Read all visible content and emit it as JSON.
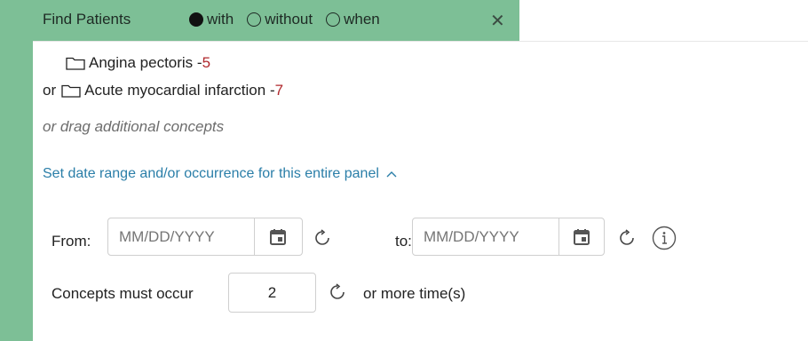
{
  "header": {
    "title": "Find Patients",
    "options": [
      {
        "label": "with",
        "selected": true
      },
      {
        "label": "without",
        "selected": false
      },
      {
        "label": "when",
        "selected": false
      }
    ],
    "close_glyph": "✕"
  },
  "concepts": [
    {
      "prefix": "",
      "name": "Angina pectoris - ",
      "count": "5"
    },
    {
      "prefix": "or",
      "name": "Acute myocardial infarction - ",
      "count": "7"
    }
  ],
  "drag_hint": "or drag additional concepts",
  "date_range_link": "Set date range and/or occurrence for this entire panel",
  "from": {
    "label": "From:",
    "placeholder": "MM/DD/YYYY",
    "value": ""
  },
  "to": {
    "label": "to:",
    "placeholder": "MM/DD/YYYY",
    "value": ""
  },
  "occurrence": {
    "label": "Concepts must occur",
    "value": "2",
    "suffix": "or more time(s)"
  },
  "colors": {
    "header_green": "#7dbf96",
    "count_red": "#b0272c",
    "link_blue": "#2a7ea8"
  },
  "icons": [
    "folder-icon",
    "calendar-icon",
    "reset-icon",
    "info-icon",
    "close-icon",
    "caret-up-icon"
  ]
}
